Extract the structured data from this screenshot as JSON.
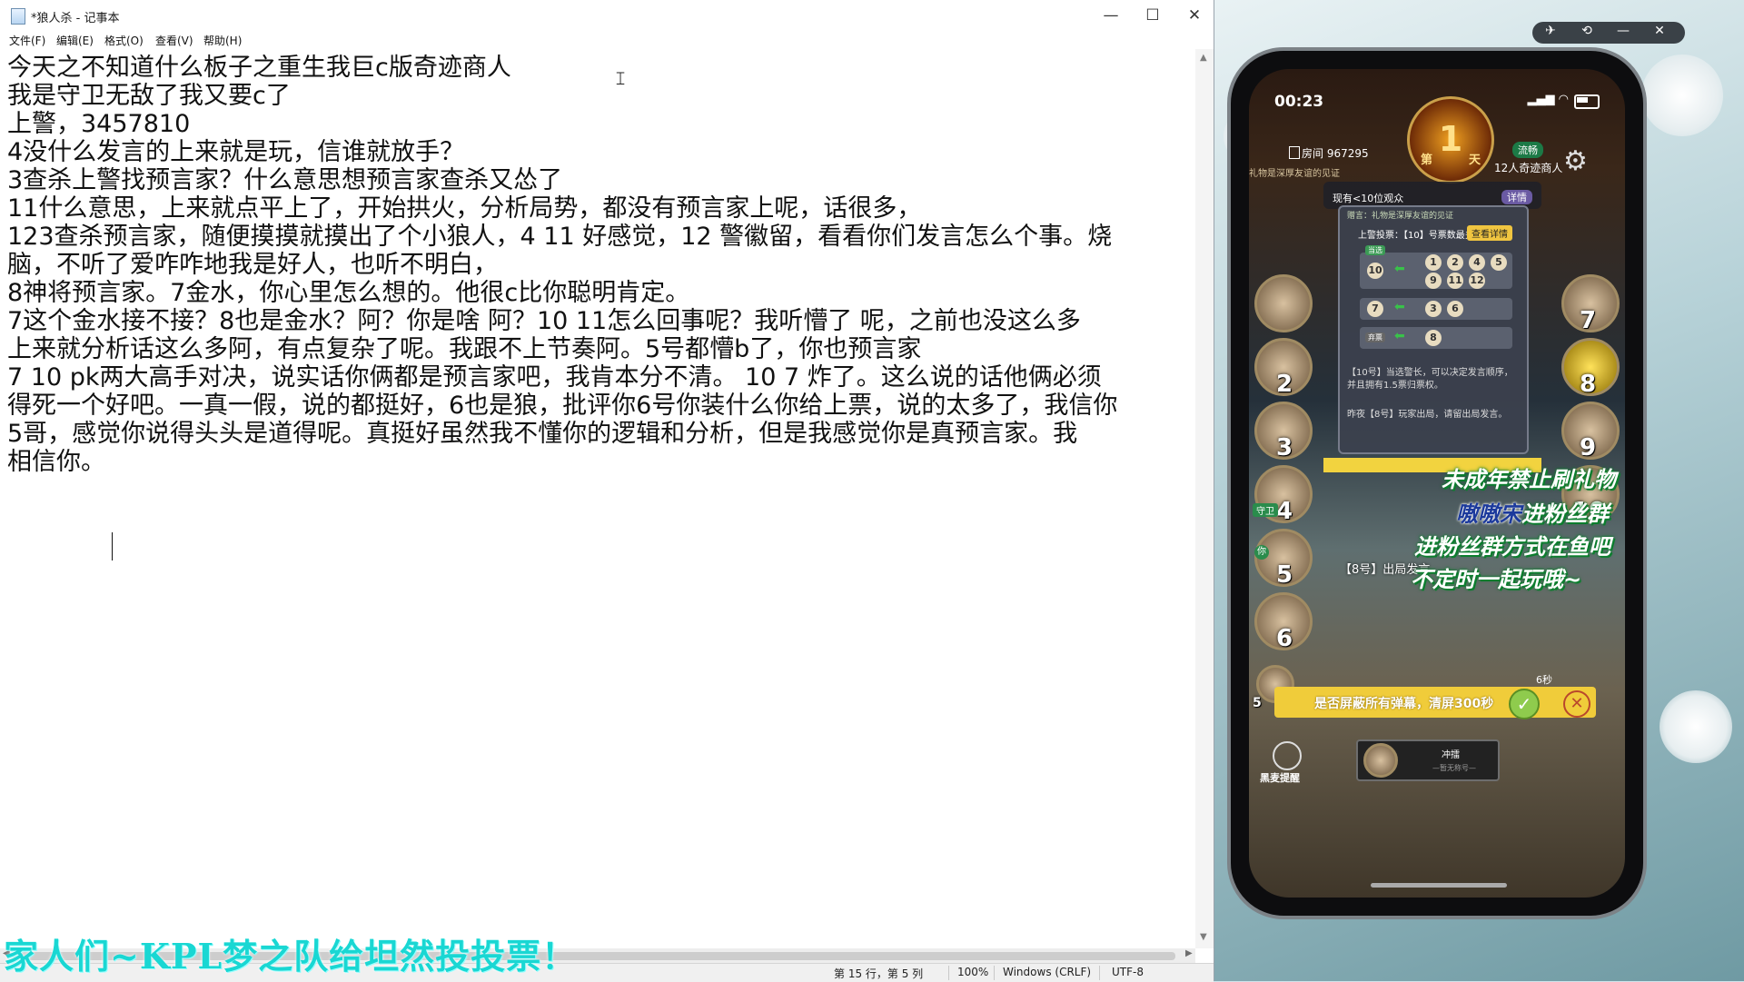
{
  "window": {
    "title": "*狼人杀 - 记事本",
    "min": "—",
    "max": "☐",
    "close": "✕"
  },
  "menu": [
    "文件(F)",
    "编辑(E)",
    "格式(O)",
    "查看(V)",
    "帮助(H)"
  ],
  "document": {
    "lines": [
      "今天之不知道什么板子之重生我巨c版奇迹商人",
      "我是守卫无敌了我又要c了",
      "上警，3457810",
      "4没什么发言的上来就是玩，信谁就放手？",
      "3查杀上警找预言家？什么意思想预言家查杀又怂了",
      "11什么意思，上来就点平上了，开始拱火，分析局势，都没有预言家上呢，话很多，",
      "123查杀预言家，随便摸摸就摸出了个小狼人，4 11 好感觉，12 警徽留，看看你们发言怎么个事。烧",
      "脑，不听了爱咋咋地我是好人，也听不明白，",
      "8神将预言家。7金水，你心里怎么想的。他很c比你聪明肯定。",
      "7这个金水接不接？8也是金水？阿？你是啥 阿？10 11怎么回事呢？我听懵了 呢，之前也没这么多",
      "上来就分析话这么多阿，有点复杂了呢。我跟不上节奏阿。5号都懵b了，你也预言家",
      "7 10 pk两大高手对决，说实话你俩都是预言家吧，我肯本分不清。  10  7 炸了。这么说的话他俩必须",
      "得死一个好吧。一真一假，说的都挺好，6也是狼，批评你6号你装什么你给上票，说的太多了，我信你",
      "5哥，感觉你说得头头是道得呢。真挺好虽然我不懂你的逻辑和分析，但是我感觉你是真预言家。我",
      "相信你。"
    ]
  },
  "status": {
    "position": "第 15 行，第 5 列",
    "zoom": "100%",
    "line_ending": "Windows (CRLF)",
    "encoding": "UTF-8"
  },
  "ticker": "家人们~KPL梦之队给坦然投投票！",
  "phone": {
    "time": "00:23",
    "day_number": "1",
    "day_label_left": "第",
    "day_label_right": "天",
    "room": "房间 967295",
    "network": "流畅",
    "mode": "12人奇迹商人",
    "marquee": "礼物是深厚友谊的见证",
    "gift_line": "赠言：礼物是深厚友谊的见证",
    "viewers": "现有<10位观众",
    "detail_btn": "详情",
    "tally_head": "上警投票：【10】号票数最多！",
    "view_btn": "查看详情",
    "elected_tag": "当选",
    "abstain_tag": "弃票",
    "row1_target": "10",
    "row1_voters_top": [
      "1",
      "2",
      "4",
      "5"
    ],
    "row1_voters_bottom": [
      "9",
      "11",
      "12"
    ],
    "row2_target": "7",
    "row2_voters": [
      "3",
      "6"
    ],
    "row3_voters": [
      "8"
    ],
    "msg1": "【10号】当选警长，可以决定发言顺序，并且拥有1.5票归票权。",
    "msg2": "昨夜【8号】玩家出局，请留出局发言。",
    "seats_left": [
      "2",
      "3",
      "4",
      "5",
      "6"
    ],
    "seats_right": [
      "7",
      "8",
      "9",
      "10"
    ],
    "guard_tag": "守卫",
    "you_tag": "你",
    "speech": "【8号】出局发言",
    "timer": "6秒",
    "confirm_text": "是否屏蔽所有弹幕，清屏300秒",
    "confirm_ok": "✓",
    "confirm_x": "✕",
    "left_seat_bottom": "5",
    "hb_label": "黑麦提醒",
    "sprint": "冲擂",
    "sprint_sub": "—暂无称号—"
  },
  "overlay": {
    "line1": "未成年禁止刷礼物",
    "line2_pre": "",
    "line2_hl": "嗷嗷宋",
    "line2_post": "进粉丝群",
    "line3": "进粉丝群方式在鱼吧",
    "line4": "不定时一起玩哦~"
  },
  "mirror_controls": [
    "✈",
    "⟲",
    "—",
    "✕"
  ],
  "side_tools": [
    "⤢",
    "📷",
    "⏺",
    "🖥",
    "✎",
    "⬚",
    "⚙"
  ]
}
